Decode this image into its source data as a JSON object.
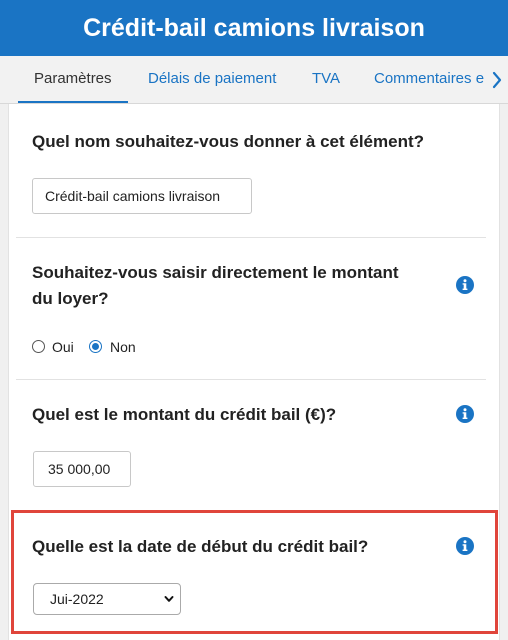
{
  "header": {
    "title": "Crédit-bail camions livraison"
  },
  "tabs": [
    {
      "label": "Paramètres",
      "active": true
    },
    {
      "label": "Délais de paiement",
      "active": false
    },
    {
      "label": "TVA",
      "active": false
    },
    {
      "label": "Commentaires e",
      "active": false
    }
  ],
  "form": {
    "name_question": "Quel nom souhaitez-vous donner à cet élément?",
    "name_value": "Crédit-bail camions livraison",
    "direct_question_line1": "Souhaitez-vous saisir directement le montant",
    "direct_question_line2": "du loyer?",
    "radio_yes": "Oui",
    "radio_no": "Non",
    "radio_selected": "Non",
    "amount_question": "Quel est le montant du crédit bail (€)?",
    "amount_value": "35 000,00",
    "date_question": "Quelle est la date de début du crédit bail?",
    "date_value": "Jui-2022"
  },
  "colors": {
    "accent": "#1a74c4",
    "highlight": "#e0453b"
  },
  "icons": {
    "info": "info-icon",
    "tab_next": "chevron-right-icon",
    "select_caret": "chevron-down-icon"
  }
}
